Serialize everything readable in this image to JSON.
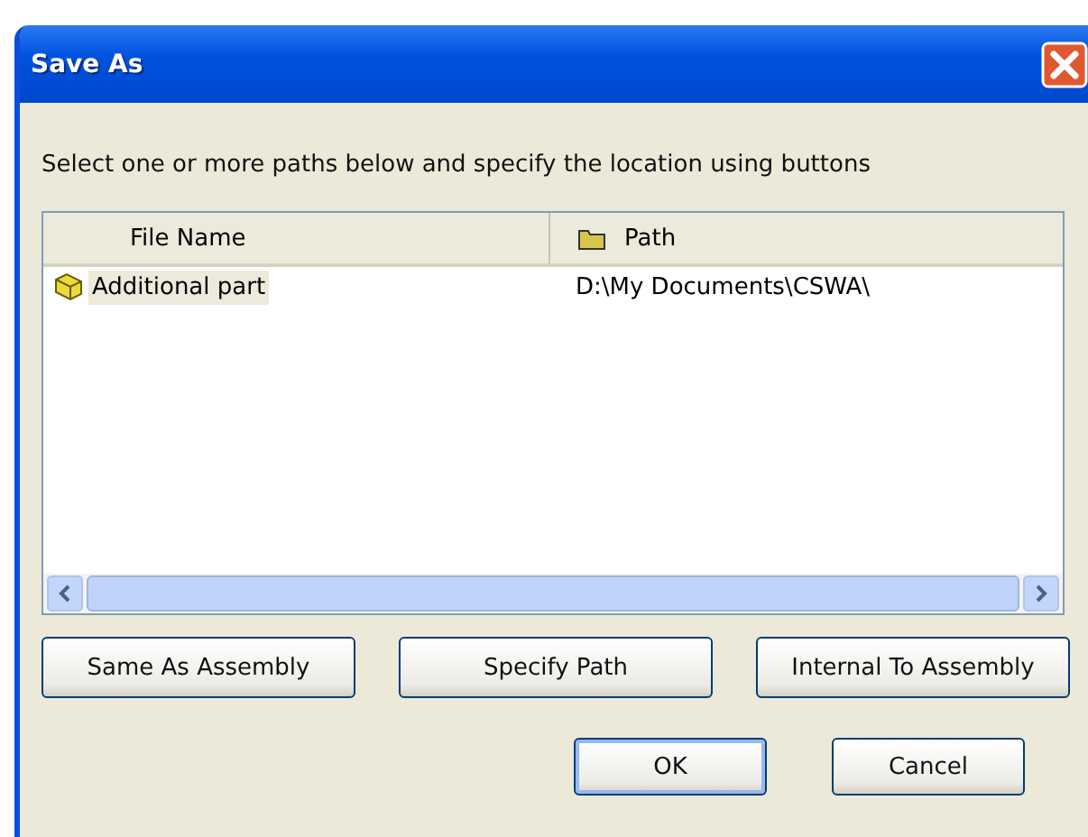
{
  "window": {
    "title": "Save As"
  },
  "instruction": "Select one or more paths below and specify the location using buttons",
  "table": {
    "columns": [
      "File Name",
      "Path"
    ],
    "rows": [
      {
        "file_name": "Additional part",
        "path": "D:\\My Documents\\CSWA\\",
        "selected": true
      }
    ]
  },
  "location_buttons": [
    "Same As Assembly",
    "Specify Path",
    "Internal To Assembly"
  ],
  "dialog_buttons": [
    {
      "label": "OK",
      "default": true
    },
    {
      "label": "Cancel",
      "default": false
    }
  ]
}
